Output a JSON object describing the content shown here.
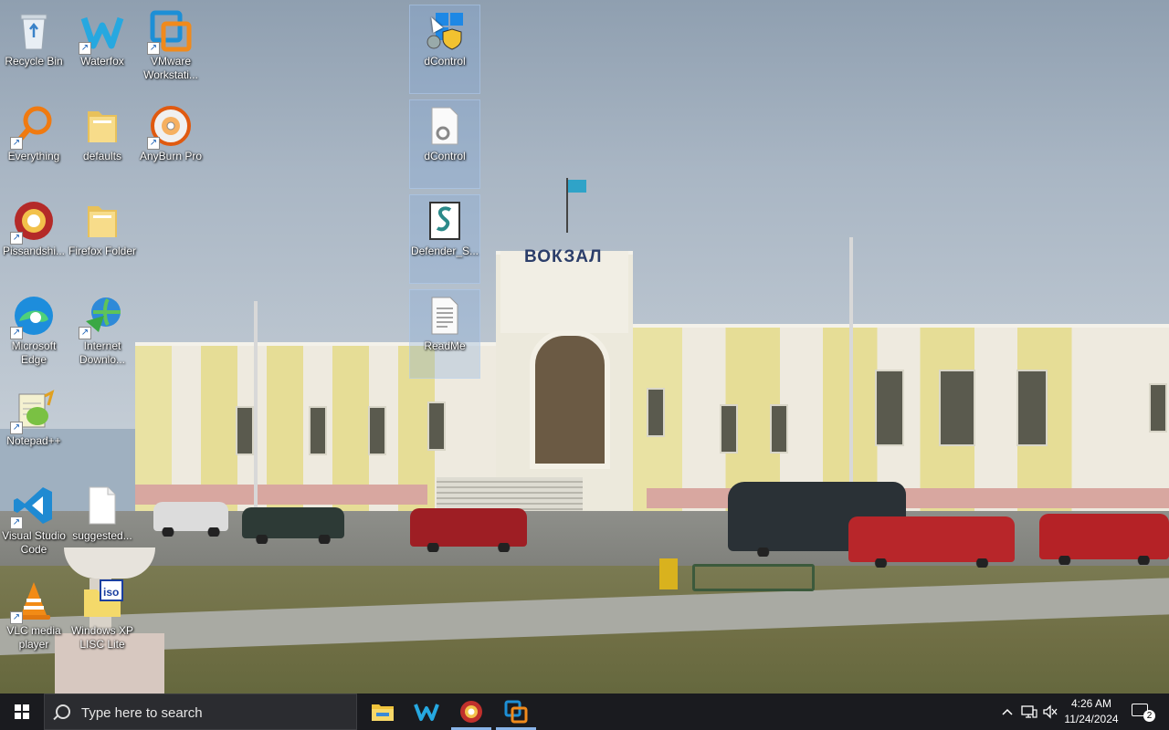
{
  "desktop": {
    "wallpaper_sign": "ВОКЗАЛ",
    "icons": [
      {
        "label": "Recycle Bin",
        "icon": "recycle-bin-icon"
      },
      {
        "label": "Waterfox",
        "icon": "waterfox-icon"
      },
      {
        "label": "VMware Workstati...",
        "icon": "vmware-icon"
      },
      {
        "label": "dControl",
        "icon": "dcontrol-shield-icon"
      },
      {
        "label": "Everything",
        "icon": "everything-search-icon"
      },
      {
        "label": "defaults",
        "icon": "folder-icon"
      },
      {
        "label": "AnyBurn Pro",
        "icon": "anyburn-disc-icon"
      },
      {
        "label": "dControl",
        "icon": "settings-file-icon"
      },
      {
        "label": "Pissandshi...",
        "icon": "browser-icon"
      },
      {
        "label": "Firefox Folder",
        "icon": "folder-icon"
      },
      {
        "label": "Defender_S...",
        "icon": "script-file-icon"
      },
      {
        "label": "Microsoft Edge",
        "icon": "edge-icon"
      },
      {
        "label": "Internet Downlo...",
        "icon": "idm-icon"
      },
      {
        "label": "ReadMe",
        "icon": "text-file-icon"
      },
      {
        "label": "Notepad++",
        "icon": "notepad-plus-plus-icon"
      },
      {
        "label": "Visual Studio Code",
        "icon": "vscode-icon"
      },
      {
        "label": "suggested...",
        "icon": "blank-file-icon"
      },
      {
        "label": "VLC media player",
        "icon": "vlc-icon"
      },
      {
        "label": "Windows XP LISC Lite",
        "icon": "iso-folder-icon"
      }
    ]
  },
  "taskbar": {
    "search_placeholder": "Type here to search",
    "pinned": [
      {
        "name": "File Explorer",
        "icon": "file-explorer-icon"
      },
      {
        "name": "Waterfox",
        "icon": "waterfox-icon"
      },
      {
        "name": "Browser",
        "icon": "browser-icon"
      },
      {
        "name": "VMware Workstation",
        "icon": "vmware-icon"
      }
    ],
    "clock_time": "4:26 AM",
    "clock_date": "11/24/2024",
    "notification_count": "2"
  }
}
